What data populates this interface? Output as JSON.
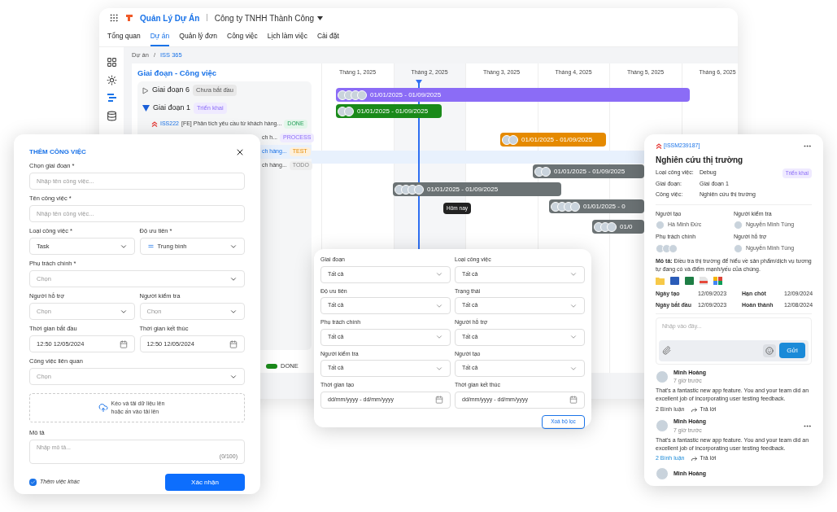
{
  "app": {
    "name": "Quản Lý Dự Án",
    "separator": "|",
    "company": "Công ty TNHH Thành Công"
  },
  "nav": [
    {
      "label": "Tổng quan",
      "selected": false
    },
    {
      "label": "Dự án",
      "selected": true
    },
    {
      "label": "Quản lý đơn",
      "selected": false
    },
    {
      "label": "Công việc",
      "selected": false
    },
    {
      "label": "Lịch làm việc",
      "selected": false
    },
    {
      "label": "Cài đặt",
      "selected": false
    }
  ],
  "breadcrumb": {
    "items": [
      "Dự án",
      "ISS 365"
    ],
    "separator": "/"
  },
  "list_title": "Giai đoạn - Công việc",
  "phases": [
    {
      "name": "Giai đoạn 6",
      "status": "Chưa bắt đầu",
      "expanded": false
    },
    {
      "name": "Giai đoạn 1",
      "status": "Triển khai",
      "expanded": true,
      "tasks": [
        {
          "id": "ISS222",
          "title": "[FE] Phân tích yêu cầu từ khách hàng...",
          "status": "DONE",
          "kind": "done",
          "selected": false
        },
        {
          "title": "ch h...",
          "status": "PROCESS",
          "kind": "process",
          "selected": false
        },
        {
          "title": "ch hàng...",
          "status": "TEST",
          "kind": "test",
          "selected": true
        },
        {
          "title": "ch hàng...",
          "status": "TODO",
          "kind": "todo",
          "selected": false
        }
      ]
    }
  ],
  "months": [
    "Tháng 1, 2025",
    "Tháng 2, 2025",
    "Tháng 3, 2025",
    "Tháng 4, 2025",
    "Tháng 5, 2025",
    "Tháng 6, 2025"
  ],
  "today_label": "Hôm nay",
  "bars": [
    {
      "dates": "01/01/2025 - 01/09/2025",
      "color": "#8b6cf6"
    },
    {
      "dates": "01/01/2025 - 01/09/2025",
      "color": "#1a8a1a"
    },
    {
      "dates": "01/01/2025 - 01/09/2025",
      "color": "#e58a00"
    },
    {
      "dates": "01/01/2025 - 01/09/2025",
      "color": "#6b7274"
    },
    {
      "dates": "01/01/2025 - 01/09/2025",
      "color": "#6b7274"
    },
    {
      "dates": "01/01/2025 - 0",
      "color": "#6b7274"
    },
    {
      "dates": "01/0",
      "color": "#6b7274"
    }
  ],
  "legend": [
    {
      "label": "DONE",
      "color": "#1a8a1a"
    }
  ],
  "form": {
    "title": "THÊM CÔNG VIỆC",
    "rows": [
      [
        {
          "kind": "text",
          "label": "Chọn giai đoạn *",
          "placeholder": "Nhập tên công việc..."
        }
      ],
      [
        {
          "kind": "text",
          "label": "Tên công việc *",
          "placeholder": "Nhập tên công việc..."
        }
      ],
      [
        {
          "kind": "select",
          "label": "Loại công việc *",
          "value": "Task"
        },
        {
          "kind": "priority",
          "label": "Độ ưu tiên *",
          "value": "Trung bình"
        }
      ],
      [
        {
          "kind": "select",
          "label": "Phụ trách chính *",
          "placeholder": "Chọn"
        }
      ],
      [
        {
          "kind": "select",
          "label": "Người hỗ trợ",
          "placeholder": "Chọn"
        },
        {
          "kind": "select",
          "label": "Người kiểm tra",
          "placeholder": "Chọn"
        }
      ],
      [
        {
          "kind": "date",
          "label": "Thời gian bắt đầu",
          "value": "12:50 12/05/2024"
        },
        {
          "kind": "date",
          "label": "Thời gian kết thúc",
          "value": "12:50 12/05/2024"
        }
      ],
      [
        {
          "kind": "select",
          "label": "Công việc liên quan",
          "placeholder": "Chọn"
        }
      ]
    ],
    "upload": "Kéo và tải dữ liệu lên hoặc ấn vào tải lên",
    "description": {
      "label": "Mô tả",
      "placeholder": "Nhập mô tả...",
      "counter": "(0/100)"
    },
    "checkbox": {
      "label": "Thêm việc khác",
      "checked": true
    },
    "submit": "Xác nhận"
  },
  "filter": {
    "fields": [
      {
        "kind": "select",
        "label": "Giai đoạn",
        "value": "Tất cả"
      },
      {
        "kind": "select",
        "label": "Loại công việc",
        "value": "Tất cả"
      },
      {
        "kind": "select",
        "label": "Độ ưu tiên",
        "value": "Tất cả"
      },
      {
        "kind": "select",
        "label": "Trạng thái",
        "value": "Tất cả"
      },
      {
        "kind": "select",
        "label": "Phụ trách chính",
        "value": "Tất cả"
      },
      {
        "kind": "select",
        "label": "Người hỗ trợ",
        "value": "Tất cả"
      },
      {
        "kind": "select",
        "label": "Người kiểm tra",
        "value": "Tất cả"
      },
      {
        "kind": "select",
        "label": "Người tạo",
        "value": "Tất cả"
      },
      {
        "kind": "date",
        "label": "Thời gian tạo",
        "value": "dd/mm/yyyy - dd/mm/yyyy"
      },
      {
        "kind": "date",
        "label": "Thời gian kết thúc",
        "value": "dd/mm/yyyy - dd/mm/yyyy"
      }
    ],
    "clear": "Xoá bộ lọc"
  },
  "detail": {
    "id": "[ISSM239187]",
    "title": "Nghiên cứu thị trường",
    "status": "Triển khai",
    "info": [
      {
        "label": "Loại công việc:",
        "value": "Debug"
      },
      {
        "label": "Giai đoạn:",
        "value": "Giai đoạn 1"
      },
      {
        "label": "Công việc:",
        "value": "Nghiên cứu thị trường"
      }
    ],
    "people": [
      {
        "label": "Người tạo",
        "name": "Hà Minh Đức"
      },
      {
        "label": "Người kiểm tra",
        "name": "Nguyễn Minh Tùng"
      },
      {
        "label": "Phụ trách chính"
      },
      {
        "label": "Người hỗ trợ",
        "name": "Nguyễn Minh Tùng"
      }
    ],
    "description": "**Mô tả:** Điều tra thị trường để hiểu về sản phẩm/dịch vụ tương tự đang có và điểm mạnh/yếu của chúng.",
    "dates": [
      {
        "label": "Ngày tạo",
        "value": "12/09/2023"
      },
      {
        "label": "Hạn chót",
        "value": "12/09/2024"
      },
      {
        "label": "Ngày bắt đầu",
        "value": "12/09/2023"
      },
      {
        "label": "Hoàn thành",
        "value": "12/08/2024"
      }
    ],
    "comment_placeholder": "Nhập vào đây...",
    "send": "Gửi",
    "comments": [
      {
        "author": "Minh Hoàng",
        "time": "7 giờ trước",
        "text": "That's a fantastic new app feature. You and your team did an excellent job of incorporating user testing feedback.",
        "replies": "2 Bình luận",
        "replies_active": false,
        "reply": "Trả lời"
      },
      {
        "author": "Minh Hoàng",
        "time": "7 giờ trước",
        "text": "That's a fantastic new app feature. You and your team did an excellent job of incorporating user testing feedback.",
        "replies": "2 Bình luận",
        "replies_active": true,
        "reply": "Trả lời"
      },
      {
        "author": "Minh Hoàng"
      }
    ]
  }
}
